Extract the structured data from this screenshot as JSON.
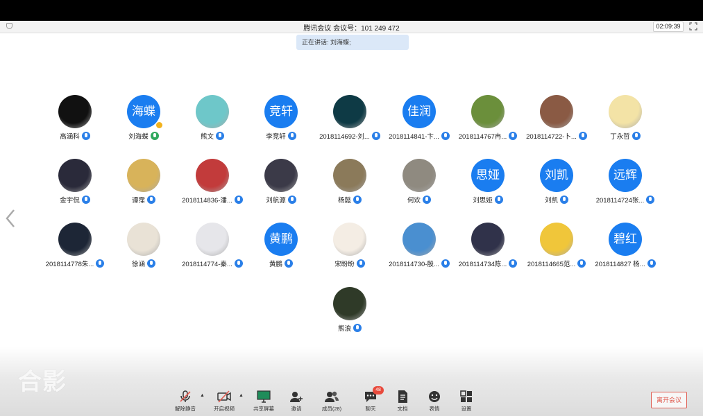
{
  "window": {
    "title": "腾讯会议 会议号：101 249 472",
    "timer": "02:09:39"
  },
  "speaking": {
    "text": "正在讲话: 刘海蝶;"
  },
  "participants": [
    {
      "name": "高涵科",
      "avatar_type": "photo",
      "avatar_color": "#111111"
    },
    {
      "name": "刘海蝶",
      "avatar_type": "text",
      "avatar_text": "海蝶",
      "mic": "active",
      "host": true
    },
    {
      "name": "熊文",
      "avatar_type": "photo",
      "avatar_color": "#6ec7c9"
    },
    {
      "name": "李竞轩",
      "avatar_type": "text",
      "avatar_text": "竞轩"
    },
    {
      "name": "2018114692-刘...",
      "avatar_type": "photo",
      "avatar_color": "#0e3a45"
    },
    {
      "name": "2018114841-卞...",
      "avatar_type": "text",
      "avatar_text": "佳润"
    },
    {
      "name": "2018114767冉...",
      "avatar_type": "photo",
      "avatar_color": "#6b8f3b"
    },
    {
      "name": "2018114722-卜...",
      "avatar_type": "photo",
      "avatar_color": "#8a5a44"
    },
    {
      "name": "丁永哲",
      "avatar_type": "photo",
      "avatar_color": "#f3e3a6"
    },
    {
      "name": "金宇侃",
      "avatar_type": "photo",
      "avatar_color": "#2a2a3a"
    },
    {
      "name": "谭霈",
      "avatar_type": "photo",
      "avatar_color": "#d8b35a"
    },
    {
      "name": "2018114836-潘...",
      "avatar_type": "photo",
      "avatar_color": "#c23b3b"
    },
    {
      "name": "刘航源",
      "avatar_type": "photo",
      "avatar_color": "#3b3a48"
    },
    {
      "name": "杨懿",
      "avatar_type": "photo",
      "avatar_color": "#8b7a5a"
    },
    {
      "name": "何欢",
      "avatar_type": "photo",
      "avatar_color": "#8f8a80"
    },
    {
      "name": "刘思娅",
      "avatar_type": "text",
      "avatar_text": "思娅"
    },
    {
      "name": "刘凯",
      "avatar_type": "text",
      "avatar_text": "刘凯"
    },
    {
      "name": "2018114724张...",
      "avatar_type": "text",
      "avatar_text": "远辉"
    },
    {
      "name": "2018114778朱...",
      "avatar_type": "photo",
      "avatar_color": "#1d2636"
    },
    {
      "name": "徐涵",
      "avatar_type": "photo",
      "avatar_color": "#e9e2d6"
    },
    {
      "name": "2018114774-秦...",
      "avatar_type": "photo",
      "avatar_color": "#e6e6ea"
    },
    {
      "name": "黄鹏",
      "avatar_type": "text",
      "avatar_text": "黄鹏"
    },
    {
      "name": "宋盼盼",
      "avatar_type": "photo",
      "avatar_color": "#f4ede4"
    },
    {
      "name": "2018114730-殷...",
      "avatar_type": "photo",
      "avatar_color": "#4a8fd0"
    },
    {
      "name": "2018114734陈...",
      "avatar_type": "photo",
      "avatar_color": "#30324a"
    },
    {
      "name": "2018114665范...",
      "avatar_type": "photo",
      "avatar_color": "#f0c63a"
    },
    {
      "name": "2018114827 杨...",
      "avatar_type": "text",
      "avatar_text": "碧红"
    },
    {
      "name": "熊浪",
      "avatar_type": "photo",
      "avatar_color": "#2f3a28"
    }
  ],
  "watermark": "合影",
  "toolbar": {
    "unmute": "解除静音",
    "video": "开启视频",
    "share": "共享屏幕",
    "invite": "邀请",
    "members": "成员(28)",
    "chat": "聊天",
    "chat_badge": "48",
    "docs": "文档",
    "reactions": "表情",
    "settings": "设置",
    "leave": "离开会议"
  },
  "colors": {
    "accent": "#1a7df0",
    "leave": "#e05a4f",
    "badge": "#e84a3c"
  }
}
